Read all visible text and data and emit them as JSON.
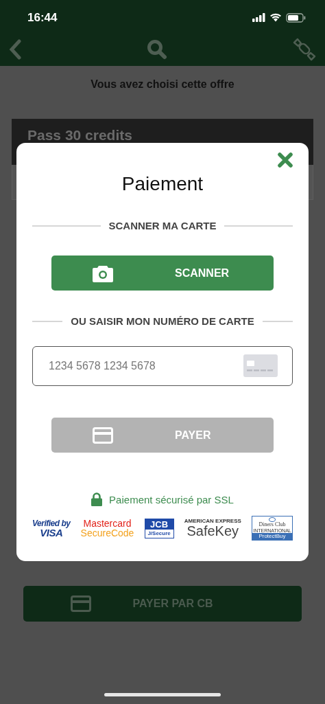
{
  "status_bar": {
    "time": "16:44"
  },
  "page": {
    "heading": "Vous avez choisi cette offre",
    "offer_title": "Pass 30 credits",
    "pay_button": {
      "label": "PAYER PAR CB",
      "disabled": false
    }
  },
  "dialog": {
    "title": "Paiement",
    "scan_heading": "SCANNER MA CARTE",
    "scan_button": {
      "label": "SCANNER",
      "disabled": false
    },
    "manual_heading": "OU SAISIR MON NUMÉRO DE CARTE",
    "card_field": {
      "placeholder": "1234 5678 1234 5678"
    },
    "pay_button": {
      "label": "PAYER",
      "disabled": true
    },
    "security_note": "Paiement sécurisé par SSL",
    "logos": [
      {
        "kind": "visa",
        "lines": [
          "Verified by",
          "VISA"
        ]
      },
      {
        "kind": "mastercard",
        "lines": [
          "Mastercard",
          "SecureCode"
        ]
      },
      {
        "kind": "jcb",
        "lines": [
          "JCB",
          "J/Secure"
        ]
      },
      {
        "kind": "amex",
        "lines": [
          "AMERICAN EXPRESS",
          "SafeKey"
        ]
      },
      {
        "kind": "diners",
        "lines": [
          "Diners Club",
          "INTERNATIONAL",
          "ProtectBuy"
        ]
      }
    ]
  }
}
